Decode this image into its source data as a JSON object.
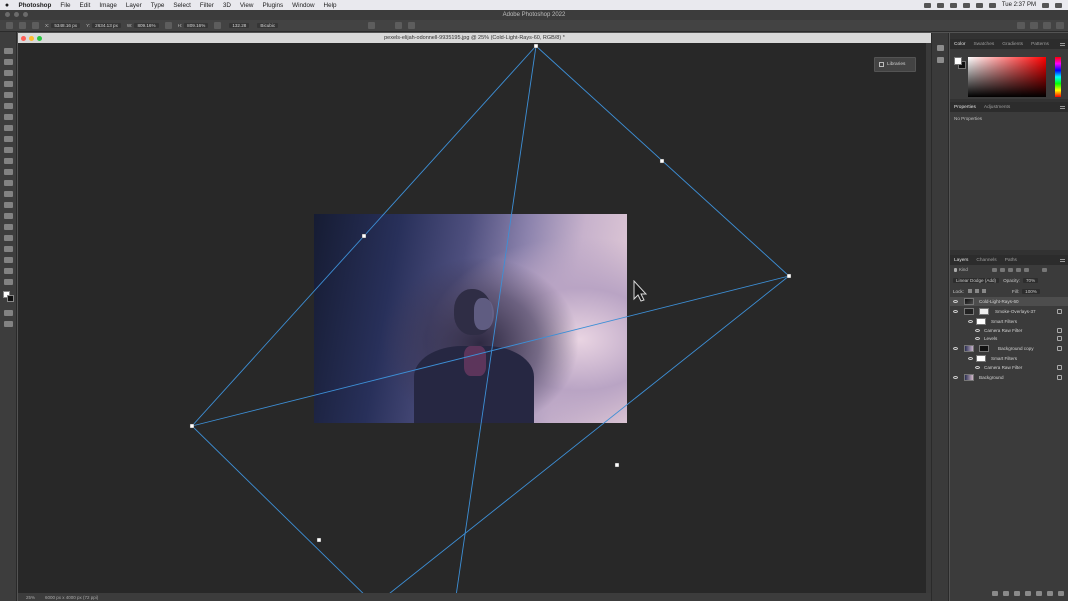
{
  "menubar": {
    "app_name": "Photoshop",
    "items": [
      "File",
      "Edit",
      "Image",
      "Layer",
      "Type",
      "Select",
      "Filter",
      "3D",
      "View",
      "Plugins",
      "Window",
      "Help"
    ],
    "clock": "Tue 2:37 PM"
  },
  "app": {
    "title": "Adobe Photoshop 2022"
  },
  "options": {
    "x_label": "X:",
    "x_value": "5348.16 px",
    "y_label": "Y:",
    "y_value": "2634.13 px",
    "w_label": "W:",
    "w_value": "809.16%",
    "h_label": "H:",
    "h_value": "809.16%",
    "angle_value": "132.28",
    "interp_value": "Bicubic"
  },
  "document": {
    "title": "pexels-elijah-odonnell-9935195.jpg @ 25% (Cold-Light-Rays-60, RGB/8) *",
    "zoom": "25%",
    "doc_info": "6000 px x 4000 px (72 ppi)"
  },
  "libraries": {
    "label": "Libraries"
  },
  "color_panel": {
    "tabs": [
      "Color",
      "Swatches",
      "Gradients",
      "Patterns"
    ]
  },
  "properties_panel": {
    "tabs": [
      "Properties",
      "Adjustments"
    ],
    "body_text": "No Properties"
  },
  "layers_panel": {
    "tabs": [
      "Layers",
      "Channels",
      "Paths"
    ],
    "filter_kind": "Kind",
    "blend_mode": "Linear Dodge (Add)",
    "opacity_label": "Opacity:",
    "opacity_value": "70%",
    "lock_label": "Lock:",
    "fill_label": "Fill:",
    "fill_value": "100%",
    "layers": [
      {
        "name": "Cold-Light-Rays-60"
      },
      {
        "name": "Smoke-Overlays-37"
      },
      {
        "name": "Smart Filters"
      },
      {
        "name": "Camera Raw Filter"
      },
      {
        "name": "Levels"
      },
      {
        "name": "Background copy"
      },
      {
        "name": "Smart Filters"
      },
      {
        "name": "Camera Raw Filter"
      },
      {
        "name": "Background"
      }
    ]
  },
  "colors": {
    "transform_line": "#3d8fd6",
    "handle": "#ffffff",
    "close": "#ff5f57",
    "minimize": "#febc2e",
    "zoom": "#28c840"
  }
}
